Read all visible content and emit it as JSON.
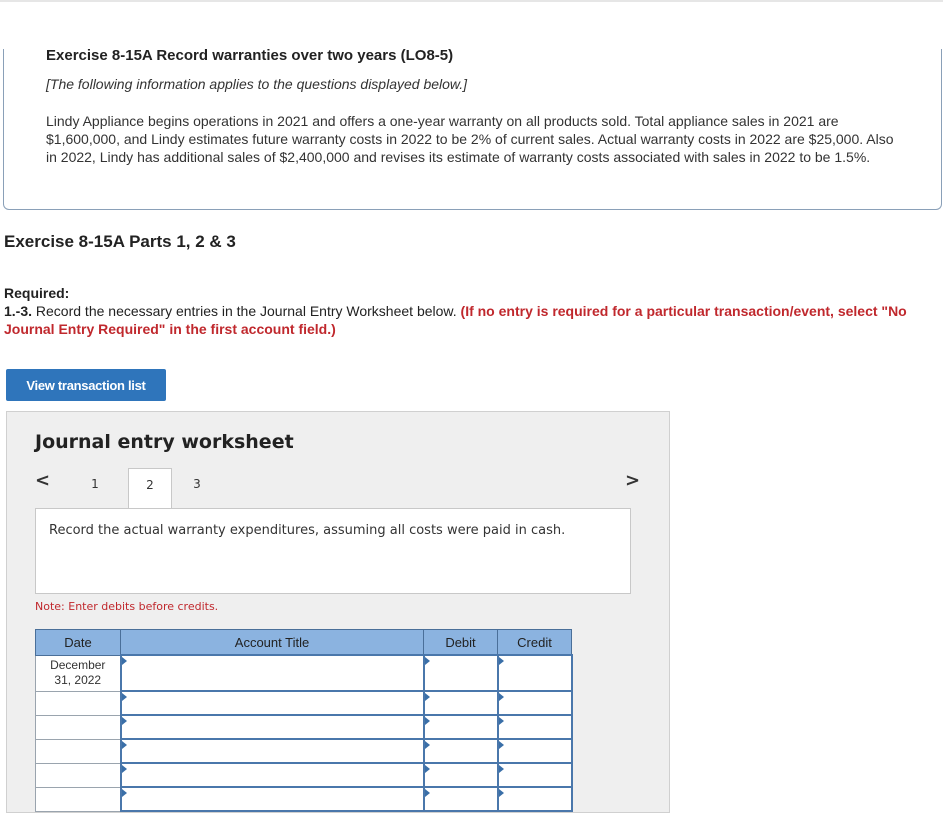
{
  "exercise": {
    "title": "Exercise 8-15A Record warranties over two years (LO8-5)",
    "subtitle": "[The following information applies to the questions displayed below.]",
    "description": "Lindy Appliance begins operations in 2021 and offers a one-year warranty on all products sold. Total appliance sales in 2021 are $1,600,000, and Lindy estimates future warranty costs in 2022 to be 2% of current sales. Actual warranty costs in 2022 are $25,000. Also in 2022, Lindy has additional sales of $2,400,000 and revises its estimate of warranty costs associated with sales in 2022 to be 1.5%."
  },
  "parts_title": "Exercise 8-15A Parts 1, 2 & 3",
  "required": {
    "label": "Required:",
    "number": "1.-3.",
    "text": "Record the necessary entries in the Journal Entry Worksheet below.",
    "note": "(If no entry is required for a particular transaction/event, select \"No Journal Entry Required\" in the first account field.)"
  },
  "view_button_label": "View transaction list",
  "worksheet": {
    "title": "Journal entry worksheet",
    "prev_icon": "chevron-left-icon",
    "next_icon": "chevron-right-icon",
    "pages": [
      "1",
      "2",
      "3"
    ],
    "active_page": "2",
    "instruction": "Record the actual warranty expenditures, assuming all costs were paid in cash.",
    "note": "Note: Enter debits before credits.",
    "columns": [
      "Date",
      "Account Title",
      "Debit",
      "Credit"
    ],
    "date_value": "December 31, 2022",
    "date_line1": "December",
    "date_line2": "31, 2022",
    "rows": [
      {
        "account": "",
        "debit": "",
        "credit": ""
      },
      {
        "account": "",
        "debit": "",
        "credit": ""
      },
      {
        "account": "",
        "debit": "",
        "credit": ""
      },
      {
        "account": "",
        "debit": "",
        "credit": ""
      },
      {
        "account": "",
        "debit": "",
        "credit": ""
      },
      {
        "account": "",
        "debit": "",
        "credit": ""
      }
    ]
  },
  "colors": {
    "button": "#2f75bb",
    "table_header": "#8bb3e0",
    "required_note": "#c0282d",
    "panel": "#efefef"
  }
}
